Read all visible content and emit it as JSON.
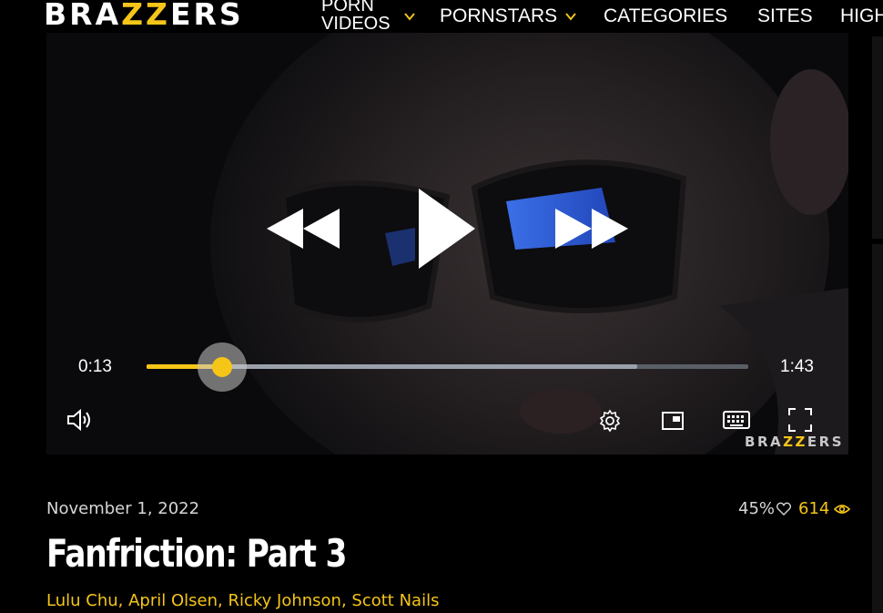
{
  "logo": {
    "before": "BRA",
    "zz": "ZZ",
    "after": "ERS"
  },
  "nav": {
    "porn_videos_line1": "PORN",
    "porn_videos_line2": "VIDEOS",
    "pornstars": "PORNSTARS",
    "categories": "CATEGORIES",
    "sites": "SITES",
    "highlights_partial": "HIGH"
  },
  "player": {
    "current_time": "0:13",
    "duration": "1:43",
    "progress_fraction": 0.126,
    "buffered_fraction": 0.816,
    "watermark": {
      "before": "BRA",
      "zz": "ZZ",
      "after": "ERS"
    },
    "controls": [
      "rewind-icon",
      "play-icon",
      "fast-forward-icon",
      "volume-icon",
      "settings-gear-icon",
      "picture-in-picture-icon",
      "keyboard-icon",
      "fullscreen-icon"
    ]
  },
  "video": {
    "date": "November 1, 2022",
    "rating": "45%",
    "views": "614",
    "title": "Fanfriction: Part 3",
    "performers": [
      "Lulu Chu",
      "April Olsen",
      "Ricky Johnson",
      "Scott Nails"
    ]
  },
  "colors": {
    "accent": "#f5c518",
    "background": "#000000"
  }
}
